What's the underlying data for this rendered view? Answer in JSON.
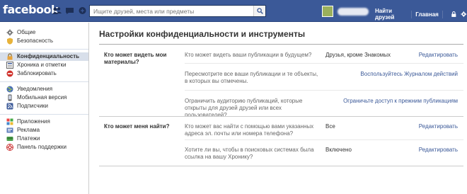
{
  "header": {
    "logo": "facebook",
    "search_placeholder": "Ищите друзей, места или предметы",
    "find_friends": "Найти друзей",
    "home": "Главная"
  },
  "sidebar": {
    "groups": [
      [
        {
          "label": "Общие",
          "icon": "gear-icon"
        },
        {
          "label": "Безопасность",
          "icon": "shield-icon"
        }
      ],
      [
        {
          "label": "Конфиденциальность",
          "icon": "lock-icon",
          "active": true
        },
        {
          "label": "Хроника и отметки",
          "icon": "timeline-icon"
        },
        {
          "label": "Заблокировать",
          "icon": "block-icon"
        }
      ],
      [
        {
          "label": "Уведомления",
          "icon": "globe-icon"
        },
        {
          "label": "Мобильная версия",
          "icon": "mobile-icon"
        },
        {
          "label": "Подписчики",
          "icon": "rss-icon"
        }
      ],
      [
        {
          "label": "Приложения",
          "icon": "apps-icon"
        },
        {
          "label": "Реклама",
          "icon": "ads-icon"
        },
        {
          "label": "Платежи",
          "icon": "payments-icon"
        },
        {
          "label": "Панель поддержки",
          "icon": "support-icon"
        }
      ]
    ]
  },
  "main": {
    "title": "Настройки конфиденциальности и инструменты",
    "sections": [
      {
        "label": "Кто может видеть мои материалы?",
        "rows": [
          {
            "question": "Кто может видеть ваши публикации в будущем?",
            "value": "Друзья, кроме Знакомых",
            "action": "Редактировать"
          },
          {
            "question": "Пересмотрите все ваши публикации и те объекты, в которых вы отмечены.",
            "value": "",
            "action": "Воспользуйтесь Журналом действий"
          },
          {
            "question": "Ограничить аудиторию публикаций, которые открыты для друзей друзей или всех пользователей?",
            "value": "",
            "action": "Ограничьте доступ к прежним публикациям"
          }
        ]
      },
      {
        "label": "Кто может меня найти?",
        "rows": [
          {
            "question": "Кто может вас найти с помощью вами указанных адреса эл. почты или номера телефона?",
            "value": "Все",
            "action": "Редактировать"
          },
          {
            "question": "Хотите ли вы, чтобы в поисковых системах была ссылка на вашу Хронику?",
            "value": "Включено",
            "action": "Редактировать"
          }
        ]
      }
    ]
  },
  "colors": {
    "brand": "#3b5998",
    "active_nav": "#d8dfea"
  }
}
